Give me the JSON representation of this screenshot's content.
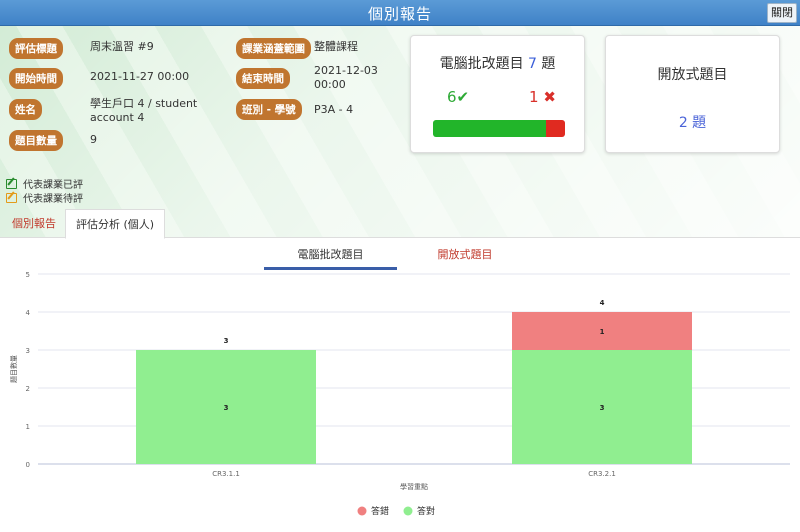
{
  "window": {
    "title": "個別報告",
    "close_label": "關閉"
  },
  "info": {
    "fields": [
      {
        "label": "評估標題",
        "value": "周末溫習 #9"
      },
      {
        "label": "開始時間",
        "value": "2021-11-27 00:00"
      },
      {
        "label": "姓名",
        "value": "學生戶口 4 / student account 4"
      },
      {
        "label": "題目數量",
        "value": "9"
      },
      {
        "label": "課業涵蓋範圍",
        "value": "整體課程"
      },
      {
        "label": "結束時間",
        "value": "2021-12-03 00:00"
      },
      {
        "label": "班別 - 學號",
        "value": "P3A - 4"
      }
    ]
  },
  "auto_card": {
    "title_prefix": "電腦批改題目",
    "count": "7",
    "unit": "題",
    "correct": "6",
    "wrong": "1",
    "correct_fraction": 0.857
  },
  "open_card": {
    "title": "開放式題目",
    "count_text": "2 題"
  },
  "legend": {
    "graded": "代表課業已評",
    "pending": "代表課業待評"
  },
  "tabs": {
    "report": "個別報告",
    "analysis": "評估分析 (個人)"
  },
  "subtabs": {
    "auto": "電腦批改題目",
    "open": "開放式題目"
  },
  "colors": {
    "correct": "#90ee90",
    "wrong": "#f08080",
    "label_bg": "#c0752f"
  },
  "chart_data": {
    "type": "bar",
    "stacked": true,
    "categories": [
      "CR3.1.1",
      "CR3.2.1"
    ],
    "series": [
      {
        "name": "答對",
        "values": [
          3,
          3
        ],
        "color": "#90ee90"
      },
      {
        "name": "答錯",
        "values": [
          0,
          1
        ],
        "color": "#f08080"
      }
    ],
    "totals": [
      3,
      4
    ],
    "xlabel": "學習重點",
    "ylabel": "題目數量",
    "ylim": [
      0,
      5
    ],
    "yticks": [
      0,
      1,
      2,
      3,
      4,
      5
    ],
    "legend_position": "bottom",
    "legend_order": [
      "答錯",
      "答對"
    ],
    "grid": true
  }
}
